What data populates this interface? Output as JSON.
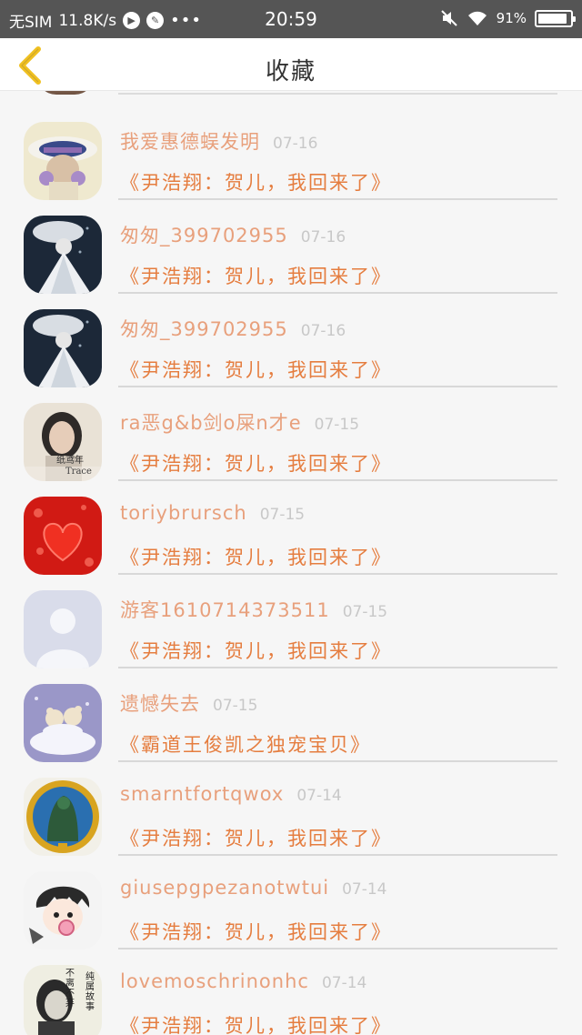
{
  "status_bar": {
    "carrier": "无SIM",
    "speed": "11.8K/s",
    "time": "20:59",
    "battery": "91%",
    "battery_level": 0.91,
    "icons": [
      "play-icon",
      "palette-icon",
      "more-dots-icon",
      "mute-icon",
      "wifi-icon",
      "battery-icon"
    ]
  },
  "header": {
    "title": "收藏",
    "back_icon": "chevron-left-icon",
    "accent_color": "#f0c020"
  },
  "items": [
    {
      "name": "我爱惠德蜈发明",
      "date": "07-16",
      "title": "《尹浩翔：贺儿，我回来了》",
      "avatar": "girl-with-hat"
    },
    {
      "name": "匆匆_399702955",
      "date": "07-16",
      "title": "《尹浩翔：贺儿，我回来了》",
      "avatar": "girl-in-white-dress"
    },
    {
      "name": "匆匆_399702955",
      "date": "07-16",
      "title": "《尹浩翔：贺儿，我回来了》",
      "avatar": "girl-in-white-dress"
    },
    {
      "name": "ra恶g&b剑o屎n才e",
      "date": "07-15",
      "title": "《尹浩翔：贺儿，我回来了》",
      "avatar": "girl-photo",
      "avatar_text": "纸鸢年",
      "avatar_text2": "Trace"
    },
    {
      "name": "toriybrursch",
      "date": "07-15",
      "title": "《尹浩翔：贺儿，我回来了》",
      "avatar": "red-heart"
    },
    {
      "name": "游客1610714373511",
      "date": "07-15",
      "title": "《尹浩翔：贺儿，我回来了》",
      "avatar": "default-user"
    },
    {
      "name": "遗憾失去",
      "date": "07-15",
      "title": "《霸道王俊凯之独宠宝贝》",
      "avatar": "bears-on-cloud"
    },
    {
      "name": "smarntfortqwox",
      "date": "07-14",
      "title": "《尹浩翔：贺儿，我回来了》",
      "avatar": "emblem"
    },
    {
      "name": "giusepgpezanotwtui",
      "date": "07-14",
      "title": "《尹浩翔：贺儿，我回来了》",
      "avatar": "anime-boy"
    },
    {
      "name": "lovemoschrinonhc",
      "date": "07-14",
      "title": "《尹浩翔：贺儿，我回来了》",
      "avatar": "bw-portrait",
      "avatar_text": "不离不弃",
      "avatar_text2": "纯属故事"
    }
  ]
}
